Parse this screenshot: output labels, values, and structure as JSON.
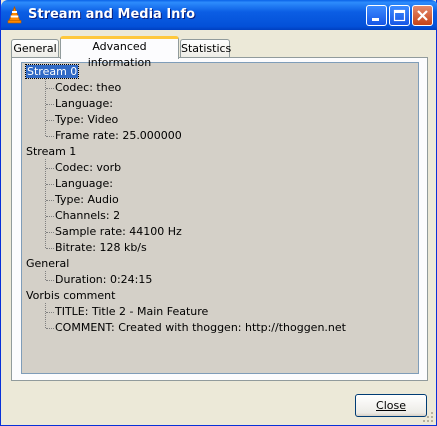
{
  "window": {
    "title": "Stream and Media Info"
  },
  "tabs": [
    {
      "label": "General"
    },
    {
      "label": "Advanced information"
    },
    {
      "label": "Statistics"
    }
  ],
  "active_tab": "Advanced information",
  "tree": {
    "stream0": {
      "label": "Stream 0",
      "codec": "Codec: theo",
      "language": "Language:",
      "type": "Type: Video",
      "frame_rate": "Frame rate: 25.000000"
    },
    "stream1": {
      "label": "Stream 1",
      "codec": "Codec: vorb",
      "language": "Language:",
      "type": "Type: Audio",
      "channels": "Channels: 2",
      "sample_rate": "Sample rate: 44100 Hz",
      "bitrate": "Bitrate: 128 kb/s"
    },
    "general": {
      "label": "General",
      "duration": "Duration: 0:24:15"
    },
    "vorbis": {
      "label": "Vorbis comment",
      "title": "TITLE: Title 2 - Main Feature",
      "comment": "COMMENT: Created with thoggen: http://thoggen.net"
    }
  },
  "buttons": {
    "close": "Close"
  },
  "icons": {
    "app": "vlc-cone-icon",
    "minimize": "minimize-icon",
    "maximize": "maximize-icon",
    "close": "close-icon"
  }
}
